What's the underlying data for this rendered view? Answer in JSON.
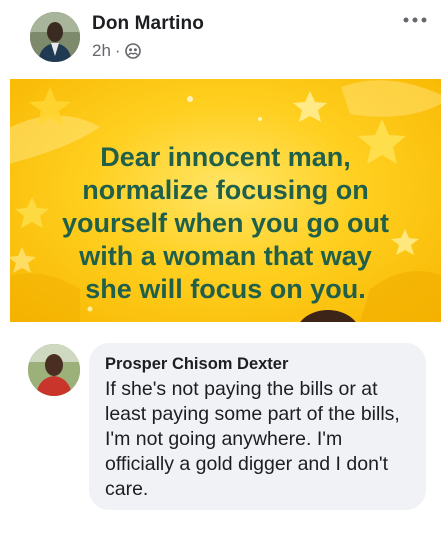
{
  "post": {
    "author_name": "Don Martino",
    "time": "2h",
    "separator": "·",
    "privacy_icon": "friends-icon",
    "more_icon": "more-horizontal-icon"
  },
  "banner": {
    "lines": [
      "Dear innocent man,",
      "normalize focusing on",
      "yourself when you go out",
      "with a woman that way",
      "she will focus on you."
    ],
    "text_color": "#20604a",
    "background_color": "#ffcf1f"
  },
  "comment": {
    "author_name": "Prosper Chisom Dexter",
    "text": "If she's not paying the bills or at least paying some part of the bills, I'm not going anywhere. I'm officially a gold digger and I don't care.",
    "bubble_color": "#f0f2f5"
  }
}
